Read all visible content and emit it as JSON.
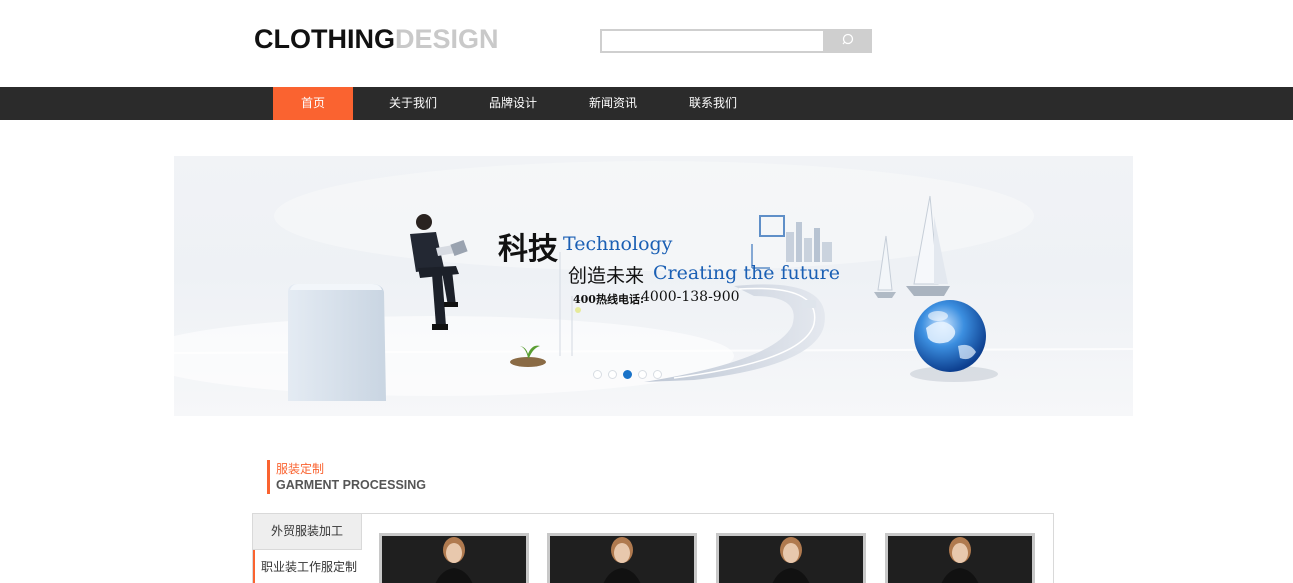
{
  "header": {
    "logo_part1": "CLOTHING",
    "logo_part2": "DESIGN",
    "search": {
      "value": "",
      "placeholder": ""
    }
  },
  "nav": {
    "items": [
      {
        "label": "首页",
        "active": true
      },
      {
        "label": "关于我们"
      },
      {
        "label": "品牌设计"
      },
      {
        "label": "新闻资讯"
      },
      {
        "label": "联系我们"
      }
    ]
  },
  "banner": {
    "headline_cn": "科技",
    "headline_en": "Technology",
    "tagline_cn": "创造未来",
    "tagline_en": "Creating the future",
    "hotline_label": "400热线电话:",
    "hotline_number": "4000-138-900",
    "slide_count": 5,
    "active_slide": 3
  },
  "section": {
    "title_cn": "服装定制",
    "title_en": "GARMENT PROCESSING"
  },
  "products": {
    "categories": [
      {
        "label": "外贸服装加工"
      },
      {
        "label": "职业装工作服定制"
      }
    ],
    "item_count": 4
  },
  "colors": {
    "accent": "#fa6330",
    "nav_bg": "#2b2b2b",
    "banner_blue": "#1a73c8"
  },
  "icons": {
    "search": "search-icon"
  }
}
